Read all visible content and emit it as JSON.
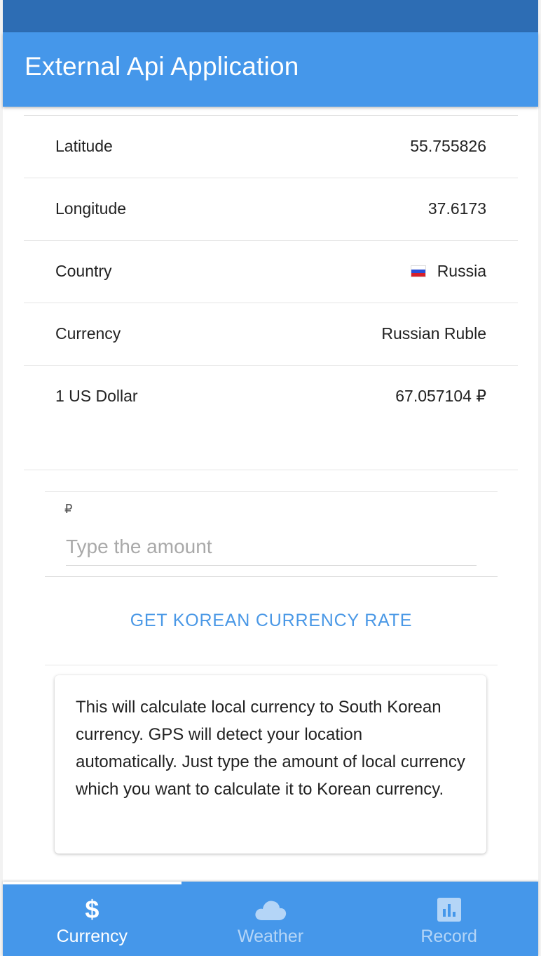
{
  "header": {
    "title": "External Api Application"
  },
  "info": {
    "rows": [
      {
        "label": "Latitude",
        "value": "55.755826"
      },
      {
        "label": "Longitude",
        "value": "37.6173"
      },
      {
        "label": "Country",
        "value": "Russia"
      },
      {
        "label": "Currency",
        "value": "Russian Ruble"
      },
      {
        "label": "1 US Dollar",
        "value": "67.057104 ₽"
      }
    ]
  },
  "amount": {
    "symbol": "₽",
    "placeholder": "Type the amount",
    "value": ""
  },
  "rate_button": {
    "label": "GET KOREAN CURRENCY RATE"
  },
  "card": {
    "text": "This will calculate local currency to South Korean currency. GPS will detect your location automatically. Just type the amount of local currency which you want to calculate it to Korean currency."
  },
  "tabs": [
    {
      "label": "Currency",
      "icon": "dollar-icon",
      "active": true
    },
    {
      "label": "Weather",
      "icon": "cloud-icon",
      "active": false
    },
    {
      "label": "Record",
      "icon": "bar-chart-icon",
      "active": false
    }
  ],
  "colors": {
    "status_bar": "#2d6db4",
    "primary": "#4597ea",
    "accent_text": "#4a98e6"
  }
}
